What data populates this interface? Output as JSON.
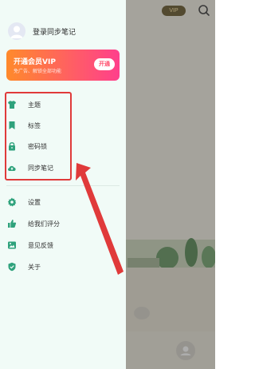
{
  "background": {
    "vip_badge": "VIP",
    "search_icon": "search-icon",
    "fab_icon": "user-icon"
  },
  "drawer": {
    "login_label": "登录同步笔记",
    "vip_card": {
      "title": "开通会员VIP",
      "subtitle": "免广告、解锁全部功能",
      "open_label": "开通"
    },
    "primary_items": [
      {
        "label": "主题",
        "icon": "shirt-icon"
      },
      {
        "label": "标签",
        "icon": "bookmark-icon"
      },
      {
        "label": "密码锁",
        "icon": "lock-icon"
      },
      {
        "label": "同步笔记",
        "icon": "cloud-upload-icon"
      }
    ],
    "secondary_items": [
      {
        "label": "设置",
        "icon": "gear-icon"
      },
      {
        "label": "给我们评分",
        "icon": "thumbs-up-icon"
      },
      {
        "label": "意见反馈",
        "icon": "feedback-icon"
      },
      {
        "label": "关于",
        "icon": "shield-check-icon"
      }
    ]
  },
  "colors": {
    "accent": "#2fa27c",
    "highlight": "#e03a3a",
    "drawer_bg": "#f1fbf7"
  }
}
